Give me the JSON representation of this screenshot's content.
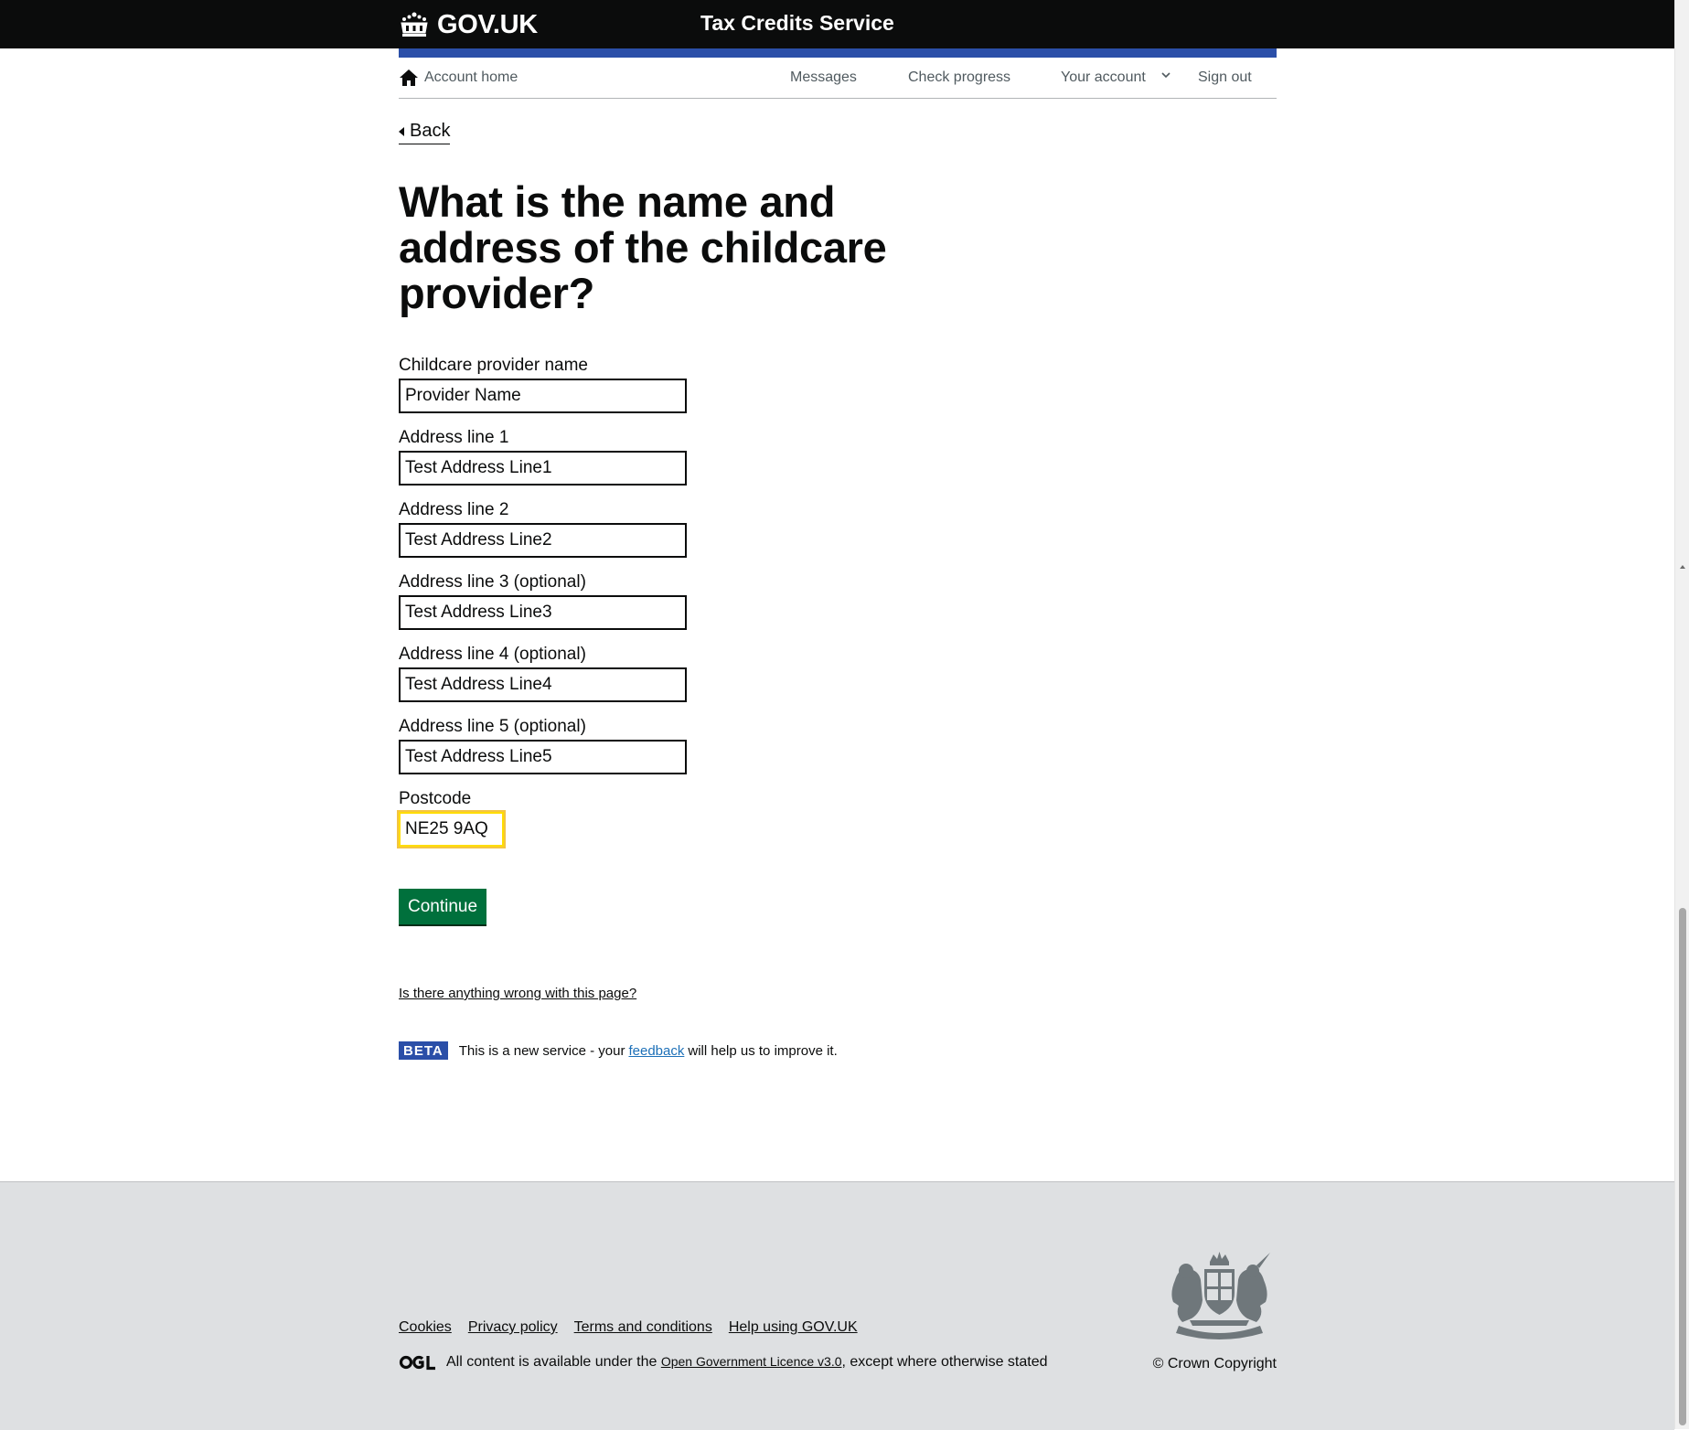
{
  "header": {
    "logo_text": "GOV.UK",
    "service_name": "Tax Credits Service",
    "icon": "crown-icon"
  },
  "account_nav": {
    "home_label": "Account home",
    "home_icon": "home-icon",
    "messages_label": "Messages",
    "check_progress_label": "Check progress",
    "your_account_label": "Your account",
    "sign_out_label": "Sign out"
  },
  "back_link": {
    "label": "Back"
  },
  "page": {
    "title": "What is the name and address of the childcare provider?"
  },
  "form": {
    "provider_name": {
      "label": "Childcare provider name",
      "value": "Provider Name"
    },
    "address_line_1": {
      "label": "Address line 1",
      "value": "Test Address Line1"
    },
    "address_line_2": {
      "label": "Address line 2",
      "value": "Test Address Line2"
    },
    "address_line_3": {
      "label": "Address line 3 (optional)",
      "value": "Test Address Line3"
    },
    "address_line_4": {
      "label": "Address line 4 (optional)",
      "value": "Test Address Line4"
    },
    "address_line_5": {
      "label": "Address line 5 (optional)",
      "value": "Test Address Line5"
    },
    "postcode": {
      "label": "Postcode",
      "value": "NE25 9AQ"
    },
    "continue_label": "Continue"
  },
  "report_link": "Is there anything wrong with this page?",
  "beta": {
    "tag": "BETA",
    "text_before": "This is a new service  - your",
    "link": "feedback",
    "text_after": "will help us to improve it."
  },
  "footer": {
    "links": [
      "Cookies",
      "Privacy policy",
      "Terms and conditions",
      "Help using GOV.UK"
    ],
    "licence_before": "All content is available under the",
    "licence_link": "Open Government Licence v3.0",
    "licence_after": ", except where otherwise stated",
    "copyright": "© Crown Copyright"
  },
  "colors": {
    "header_bg": "#0b0c0c",
    "blue_bar": "#2b4fa8",
    "button_green": "#00703c",
    "focus_yellow": "#ffdd00",
    "footer_bg": "#dee0e2"
  }
}
